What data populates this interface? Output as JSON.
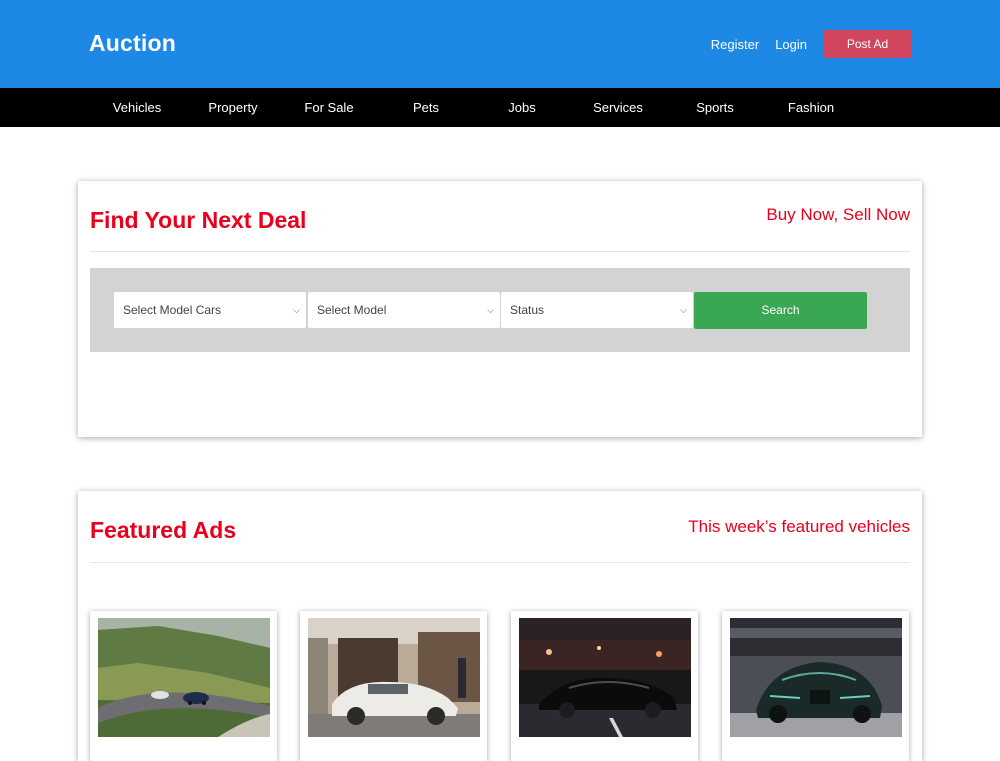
{
  "header": {
    "logo": "Auction",
    "register": "Register",
    "login": "Login",
    "post_ad": "Post Ad"
  },
  "nav": {
    "items": [
      {
        "label": "Vehicles"
      },
      {
        "label": "Property"
      },
      {
        "label": "For Sale"
      },
      {
        "label": "Pets"
      },
      {
        "label": "Jobs"
      },
      {
        "label": "Services"
      },
      {
        "label": "Sports"
      },
      {
        "label": "Fashion"
      }
    ]
  },
  "search_panel": {
    "title": "Find Your Next Deal",
    "subtitle": "Buy Now, Sell Now",
    "select_make": "Select Model Cars",
    "select_model": "Select Model",
    "select_status": "Status",
    "search_button": "Search"
  },
  "featured": {
    "title": "Featured Ads",
    "subtitle": "This week’s featured vehicles",
    "cards": [
      {
        "image": "cars-on-mountain-road"
      },
      {
        "image": "white-sports-car-at-storefront"
      },
      {
        "image": "black-car-at-auto-show"
      },
      {
        "image": "dark-hypercar-at-auto-show"
      }
    ]
  },
  "colors": {
    "header_bg": "#1e88e5",
    "nav_bg": "#000000",
    "accent_red": "#e8001c",
    "post_ad_bg": "#d1455e",
    "search_button_bg": "#3aa753",
    "search_band_bg": "#d3d3d3"
  }
}
